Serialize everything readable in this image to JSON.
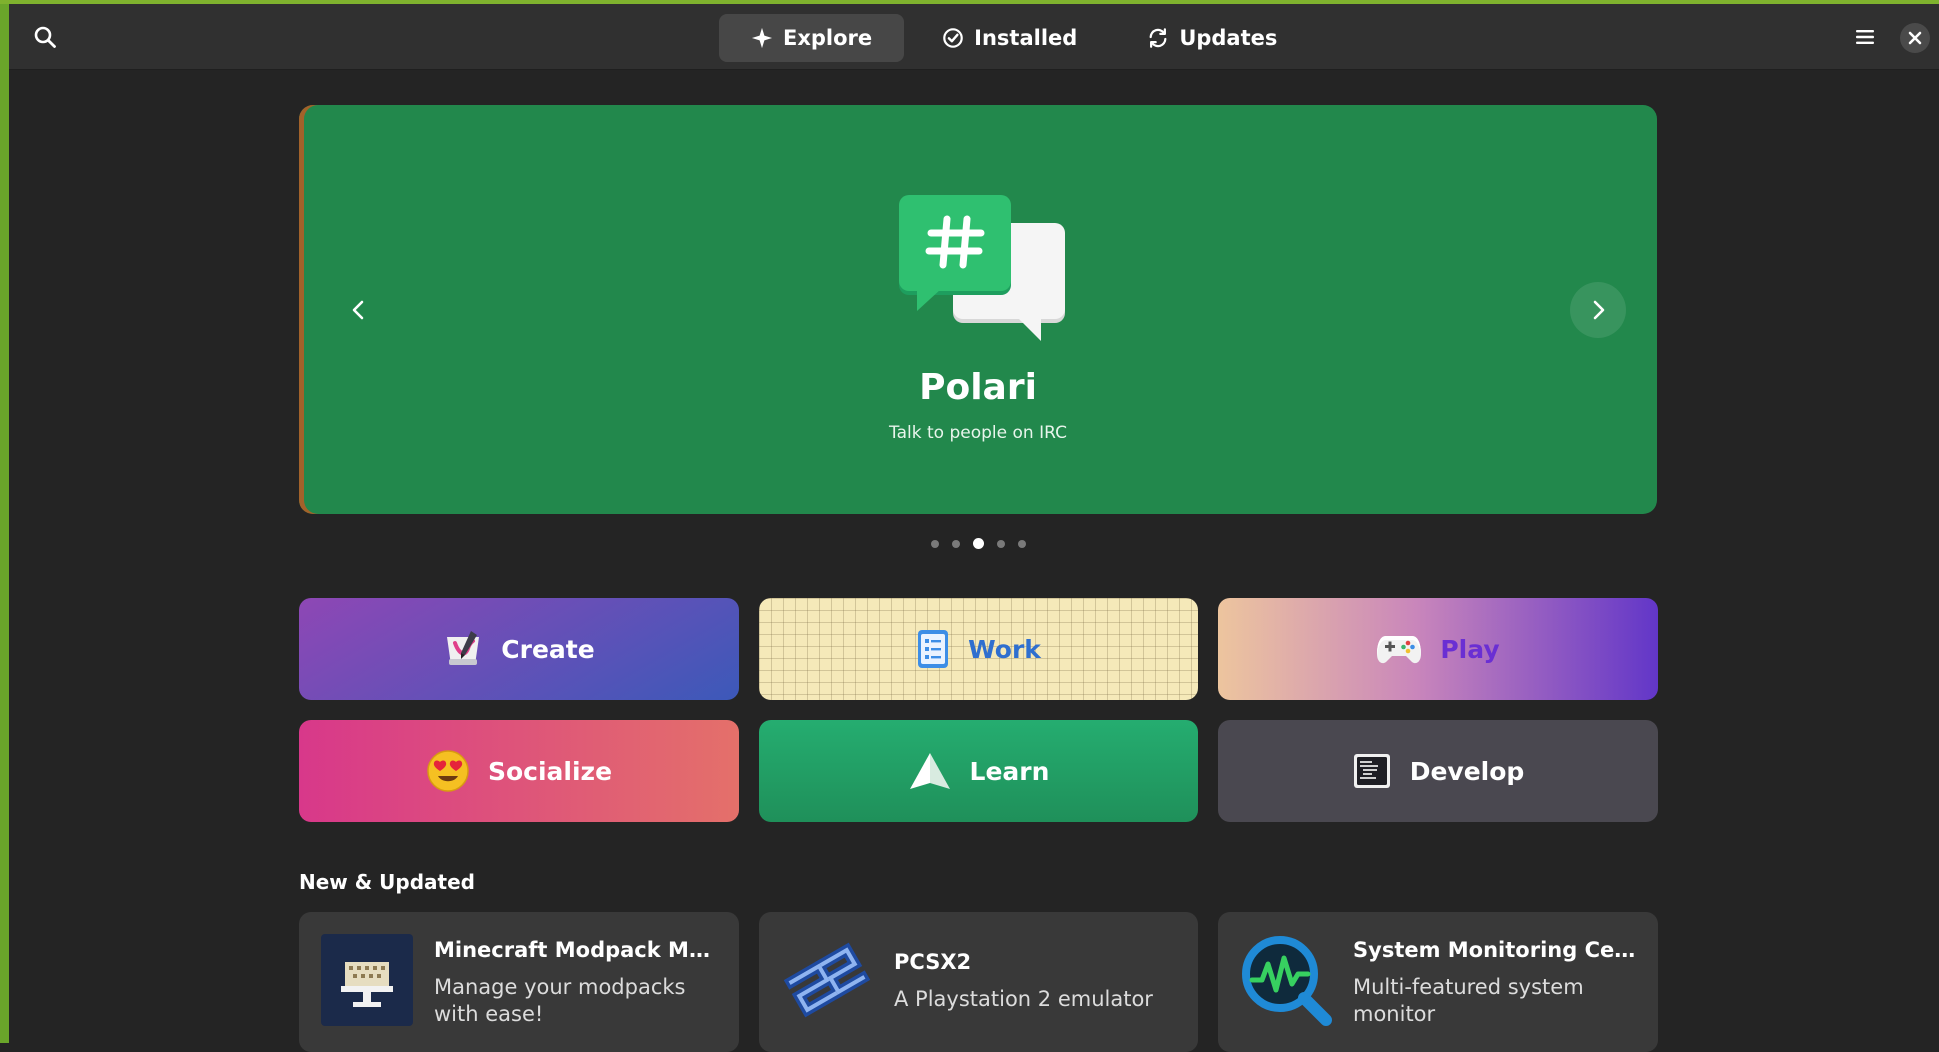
{
  "header": {
    "tabs": [
      {
        "label": "Explore",
        "icon": "sparkle-icon",
        "active": true
      },
      {
        "label": "Installed",
        "icon": "check-circle-icon",
        "active": false
      },
      {
        "label": "Updates",
        "icon": "refresh-icon",
        "active": false
      }
    ],
    "icons": {
      "search": "search-icon",
      "menu": "hamburger-menu-icon",
      "close": "close-icon"
    }
  },
  "featured": {
    "title": "Polari",
    "subtitle": "Talk to people on IRC",
    "icon": "chat-bubbles-hash-icon",
    "background_color": "#22884c",
    "dots": {
      "count": 5,
      "active_index": 2
    }
  },
  "categories": [
    {
      "label": "Create",
      "icon": "paint-palette-icon"
    },
    {
      "label": "Work",
      "icon": "checklist-document-icon"
    },
    {
      "label": "Play",
      "icon": "gamepad-icon"
    },
    {
      "label": "Socialize",
      "icon": "heart-eyes-emoji-icon"
    },
    {
      "label": "Learn",
      "icon": "paper-sail-icon"
    },
    {
      "label": "Develop",
      "icon": "code-terminal-icon"
    }
  ],
  "new_updated": {
    "title": "New & Updated",
    "apps": [
      {
        "name": "Minecraft Modpack Mana...",
        "description": "Manage your modpacks with ease!",
        "icon": "minecraft-modpack-icon"
      },
      {
        "name": "PCSX2",
        "description": "A Playstation 2 emulator",
        "icon": "pcsx2-logo-icon"
      },
      {
        "name": "System Monitoring Center",
        "description": "Multi-featured system monitor",
        "icon": "system-monitor-magnifier-icon"
      }
    ]
  },
  "colors": {
    "window_bg": "#242424",
    "headerbar_bg": "#303030",
    "accent_green": "#22884c",
    "frame_green": "#6aa52a"
  }
}
